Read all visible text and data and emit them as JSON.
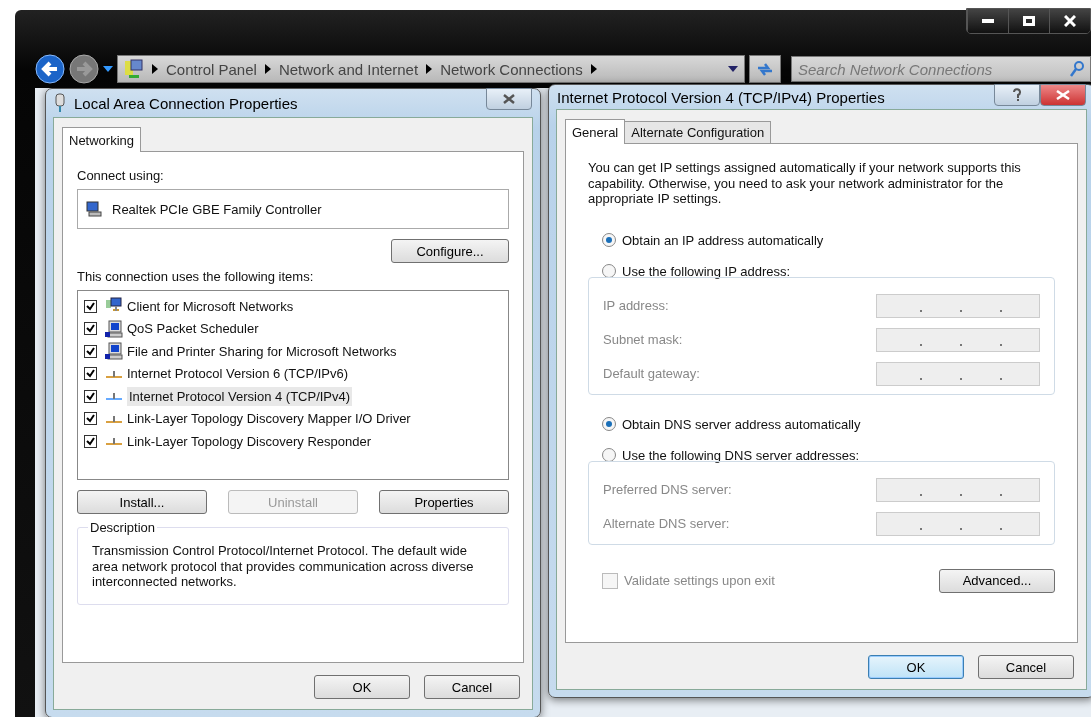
{
  "explorer": {
    "breadcrumb": [
      "Control Panel",
      "Network and Internet",
      "Network Connections"
    ],
    "search": {
      "placeholder": "Search Network Connections"
    }
  },
  "lan_dialog": {
    "title": "Local Area Connection Properties",
    "tabs": [
      {
        "label": "Networking",
        "selected": true
      }
    ],
    "connect_label": "Connect using:",
    "adapter": "Realtek PCIe GBE Family Controller",
    "configure_button": "Configure...",
    "items_label": "This connection uses the following items:",
    "items": [
      {
        "label": "Client for Microsoft Networks",
        "checked": true,
        "selected": false,
        "kind": "client"
      },
      {
        "label": "QoS Packet Scheduler",
        "checked": true,
        "selected": false,
        "kind": "service"
      },
      {
        "label": "File and Printer Sharing for Microsoft Networks",
        "checked": true,
        "selected": false,
        "kind": "service"
      },
      {
        "label": "Internet Protocol Version 6 (TCP/IPv6)",
        "checked": true,
        "selected": false,
        "kind": "protocol"
      },
      {
        "label": "Internet Protocol Version 4 (TCP/IPv4)",
        "checked": true,
        "selected": true,
        "kind": "protocol"
      },
      {
        "label": "Link-Layer Topology Discovery Mapper I/O Driver",
        "checked": true,
        "selected": false,
        "kind": "protocol"
      },
      {
        "label": "Link-Layer Topology Discovery Responder",
        "checked": true,
        "selected": false,
        "kind": "protocol"
      }
    ],
    "item_buttons": [
      {
        "label": "Install...",
        "disabled": false
      },
      {
        "label": "Uninstall",
        "disabled": true
      },
      {
        "label": "Properties",
        "disabled": false
      }
    ],
    "description": {
      "legend": "Description",
      "text": "Transmission Control Protocol/Internet Protocol. The default wide area network protocol that provides communication across diverse interconnected networks."
    },
    "footer_buttons": [
      {
        "label": "OK",
        "default": false
      },
      {
        "label": "Cancel",
        "default": false
      }
    ]
  },
  "ipv4_dialog": {
    "title": "Internet Protocol Version 4 (TCP/IPv4) Properties",
    "tabs": [
      {
        "label": "General",
        "selected": true
      },
      {
        "label": "Alternate Configuration",
        "selected": false
      }
    ],
    "intro": "You can get IP settings assigned automatically if your network supports this capability. Otherwise, you need to ask your network administrator for the appropriate IP settings.",
    "ip_auto": {
      "label": "Obtain an IP address automatically",
      "selected": true
    },
    "ip_manual": {
      "label": "Use the following IP address:",
      "selected": false
    },
    "ip_fields": [
      {
        "label": "IP address:",
        "disabled": true
      },
      {
        "label": "Subnet mask:",
        "disabled": true
      },
      {
        "label": "Default gateway:",
        "disabled": true
      }
    ],
    "dns_auto": {
      "label": "Obtain DNS server address automatically",
      "selected": true
    },
    "dns_manual": {
      "label": "Use the following DNS server addresses:",
      "selected": false
    },
    "dns_fields": [
      {
        "label": "Preferred DNS server:",
        "disabled": true
      },
      {
        "label": "Alternate DNS server:",
        "disabled": true
      }
    ],
    "validate": {
      "label": "Validate settings upon exit",
      "checked": false,
      "disabled": true
    },
    "advanced_button": "Advanced...",
    "footer_buttons": [
      {
        "label": "OK",
        "default": true
      },
      {
        "label": "Cancel",
        "default": false
      }
    ]
  }
}
